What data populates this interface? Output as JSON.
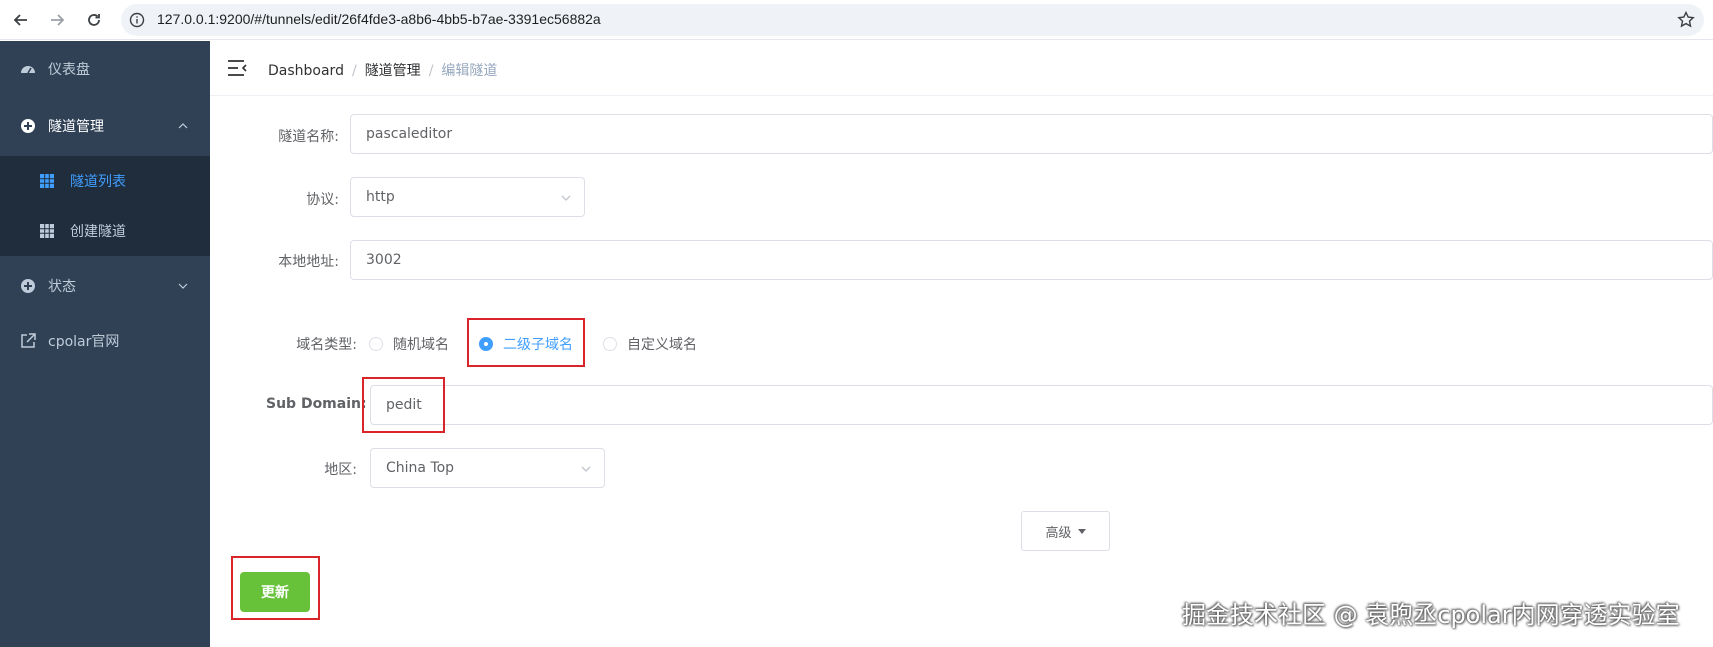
{
  "browser": {
    "url": "127.0.0.1:9200/#/tunnels/edit/26f4fde3-a8b6-4bb5-b7ae-3391ec56882a"
  },
  "sidebar": {
    "items": [
      {
        "label": "仪表盘",
        "icon": "dashboard-icon"
      },
      {
        "label": "隧道管理",
        "icon": "tunnel-icon"
      },
      {
        "label": "状态",
        "icon": "status-icon"
      },
      {
        "label": "cpolar官网",
        "icon": "external-link-icon"
      }
    ],
    "submenu": [
      {
        "label": "隧道列表",
        "icon": "grid-icon",
        "active": true
      },
      {
        "label": "创建隧道",
        "icon": "grid-icon",
        "active": false
      }
    ],
    "colors": {
      "bg": "#304156",
      "submenu_bg": "#1f2d3d",
      "text": "#bfcbd9",
      "active": "#409eff"
    }
  },
  "breadcrumb": {
    "items": [
      "Dashboard",
      "隧道管理",
      "编辑隧道"
    ],
    "separator": "/"
  },
  "form": {
    "name_label": "隧道名称:",
    "name_value": "pascaleditor",
    "protocol_label": "协议:",
    "protocol_value": "http",
    "local_label": "本地地址:",
    "local_value": "3002",
    "domain_type_label": "域名类型:",
    "domain_types": [
      "随机域名",
      "二级子域名",
      "自定义域名"
    ],
    "domain_type_selected": "二级子域名",
    "subdomain_label": "Sub Domain:",
    "subdomain_value": "pedit",
    "region_label": "地区:",
    "region_value": "China Top",
    "advanced_label": "高级",
    "update_label": "更新"
  },
  "watermark": "掘金技术社区 @ 袁煦丞cpolar内网穿透实验室",
  "colors": {
    "primary": "#409eff",
    "success": "#67c23a",
    "highlight": "#d9252a"
  }
}
